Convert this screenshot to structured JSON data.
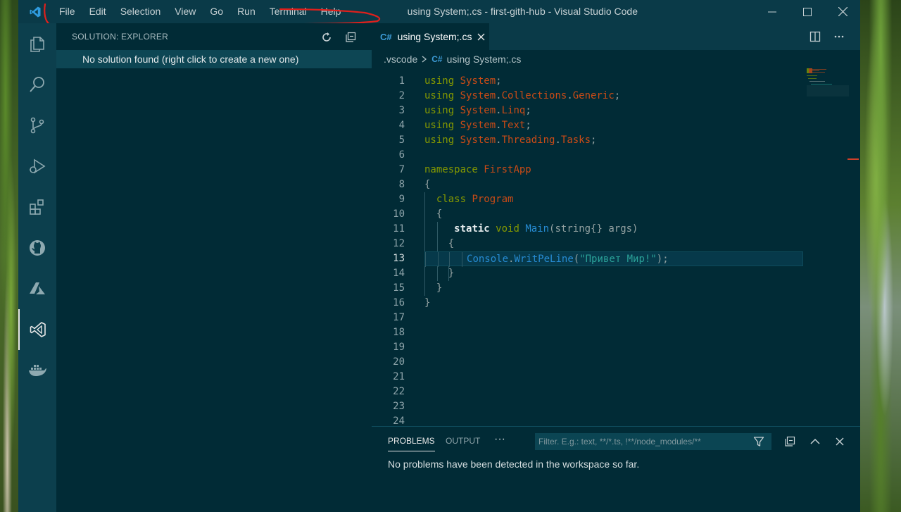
{
  "window": {
    "title": "using System;.cs - first-gith-hub - Visual Studio Code",
    "menu": [
      "File",
      "Edit",
      "Selection",
      "View",
      "Go",
      "Run",
      "Terminal",
      "Help"
    ]
  },
  "activitybar": {
    "items": [
      {
        "name": "explorer",
        "icon": "files-icon"
      },
      {
        "name": "search",
        "icon": "search-icon"
      },
      {
        "name": "source-control",
        "icon": "source-control-icon"
      },
      {
        "name": "run-debug",
        "icon": "run-debug-icon"
      },
      {
        "name": "extensions",
        "icon": "extensions-icon"
      },
      {
        "name": "github",
        "icon": "github-icon"
      },
      {
        "name": "azure",
        "icon": "azure-icon"
      },
      {
        "name": "solution-explorer",
        "icon": "visual-studio-icon",
        "active": true
      },
      {
        "name": "docker",
        "icon": "docker-icon"
      }
    ]
  },
  "sidebar": {
    "title": "SOLUTION: EXPLORER",
    "empty_message": "No solution found (right click to create a new one)"
  },
  "editor": {
    "tab": {
      "lang": "C#",
      "label": "using System;.cs"
    },
    "breadcrumb": {
      "folder": ".vscode",
      "lang": "C#",
      "file": "using System;.cs"
    },
    "current_line": 13,
    "line_count": 24
  },
  "panel": {
    "tabs": [
      "PROBLEMS",
      "OUTPUT"
    ],
    "more": "···",
    "filter_placeholder": "Filter. E.g.: text, **/*.ts, !**/node_modules/**",
    "message": "No problems have been detected in the workspace so far."
  },
  "colors": {
    "background": "#012b36",
    "keyword": "#859900",
    "type": "#cb4b16",
    "function": "#268bd2",
    "string": "#2aa198",
    "annotation": "#e0201c"
  }
}
